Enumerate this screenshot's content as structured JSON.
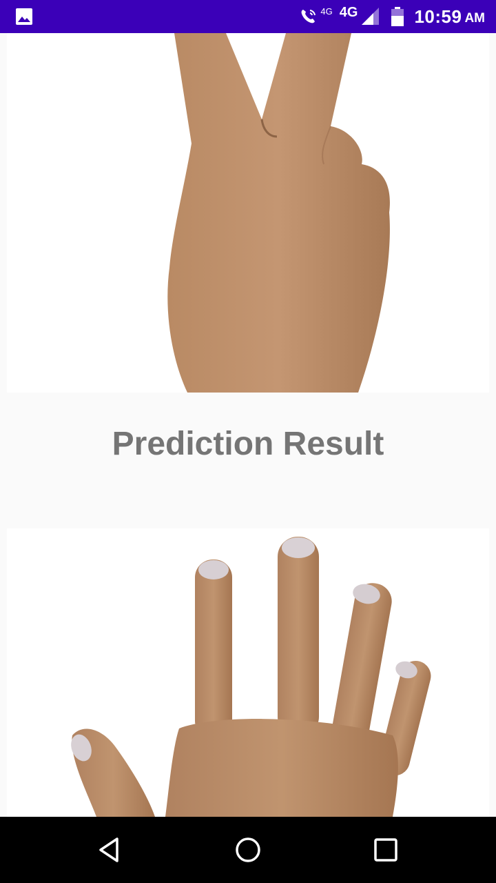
{
  "status_bar": {
    "call_network": "4G",
    "network": "4G",
    "time": "10:59",
    "ampm": "AM",
    "background_color": "#3b00b8"
  },
  "content": {
    "result_title": "Prediction Result",
    "title_color": "#757575",
    "top_image": "hand-two-fingers-scissors",
    "bottom_image": "hand-open-palm-paper"
  },
  "nav_bar": {
    "icons": [
      "back-triangle-icon",
      "home-circle-icon",
      "recents-square-icon"
    ]
  }
}
